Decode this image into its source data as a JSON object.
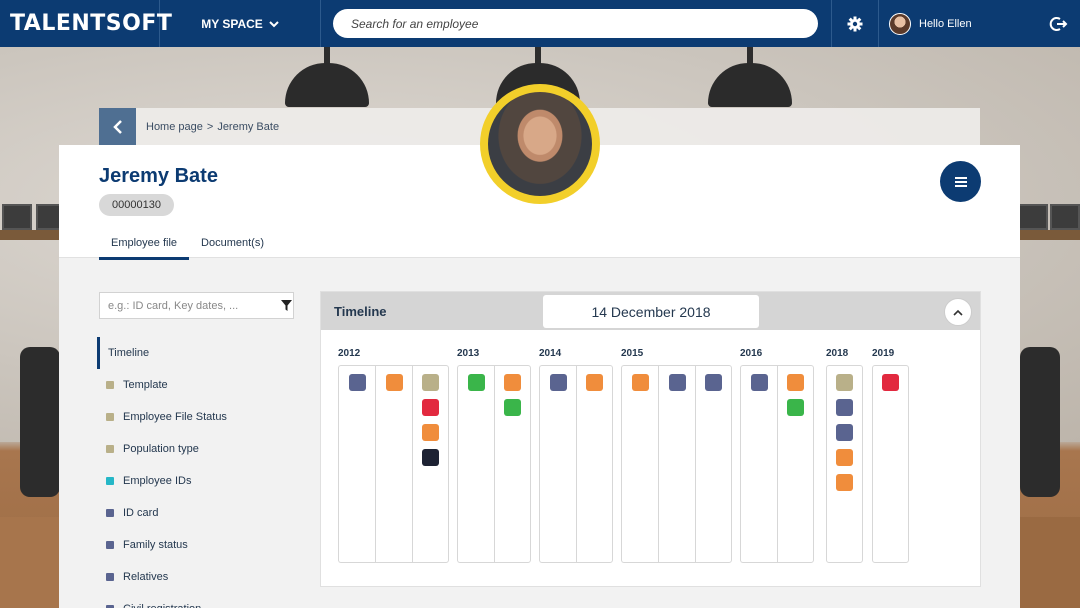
{
  "topbar": {
    "logo": "TALENTSOFT",
    "my_space": "MY SPACE",
    "search_placeholder": "Search for an employee",
    "greeting": "Hello Ellen"
  },
  "breadcrumb": {
    "home": "Home page",
    "separator": ">",
    "current": "Jeremy Bate"
  },
  "employee": {
    "name": "Jeremy Bate",
    "id": "00000130"
  },
  "tabs": [
    {
      "label": "Employee file",
      "active": true
    },
    {
      "label": "Document(s)",
      "active": false
    }
  ],
  "filter": {
    "placeholder": "e.g.: ID card, Key dates, ..."
  },
  "sections": [
    {
      "label": "Timeline",
      "active": true,
      "color": ""
    },
    {
      "label": "Template",
      "color": "#b9b089"
    },
    {
      "label": "Employee File Status",
      "color": "#b9b089"
    },
    {
      "label": "Population type",
      "color": "#b9b089"
    },
    {
      "label": "Employee IDs",
      "color": "#25b7c7"
    },
    {
      "label": "ID card",
      "color": "#5a6490"
    },
    {
      "label": "Family status",
      "color": "#5a6490"
    },
    {
      "label": "Relatives",
      "color": "#5a6490"
    },
    {
      "label": "Civil registration",
      "color": "#5a6490"
    }
  ],
  "timeline": {
    "title": "Timeline",
    "date": "14 December 2018",
    "colors": {
      "slate": "#5a6490",
      "orange": "#f08d3c",
      "khaki": "#b9b089",
      "red": "#e2293f",
      "black": "#1d2233",
      "green": "#3ab54a"
    },
    "years": [
      {
        "year": "2012",
        "columns": [
          [
            "slate"
          ],
          [
            "orange"
          ],
          [
            "khaki",
            "red",
            "orange",
            "black"
          ]
        ]
      },
      {
        "year": "2013",
        "columns": [
          [
            "green"
          ],
          [
            "orange",
            "green"
          ]
        ]
      },
      {
        "year": "2014",
        "columns": [
          [
            "slate"
          ],
          [
            "orange"
          ]
        ]
      },
      {
        "year": "2015",
        "columns": [
          [
            "orange"
          ],
          [
            "slate"
          ],
          [
            "slate"
          ]
        ]
      },
      {
        "year": "2016",
        "columns": [
          [
            "slate"
          ],
          [
            "orange",
            "green"
          ]
        ]
      },
      {
        "year": "2018",
        "columns": [
          [
            "khaki",
            "slate",
            "slate",
            "orange",
            "orange"
          ]
        ]
      },
      {
        "year": "2019",
        "columns": [
          [
            "red"
          ]
        ]
      }
    ]
  }
}
